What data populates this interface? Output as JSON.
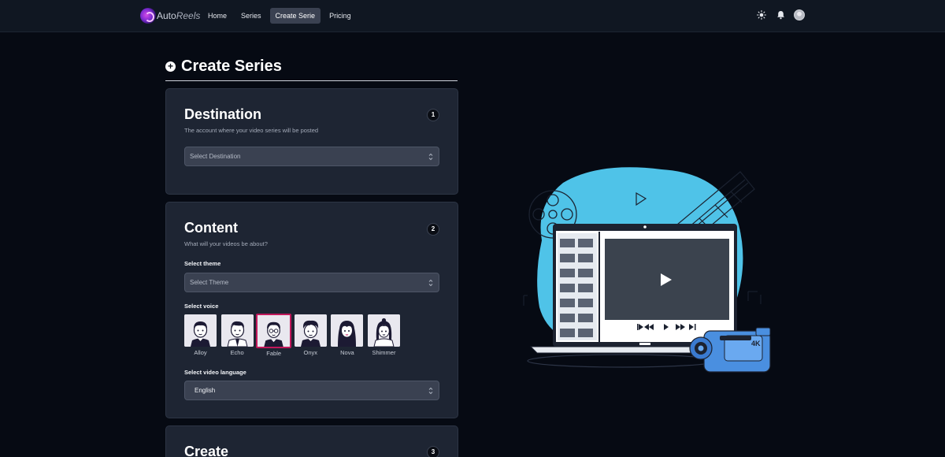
{
  "navbar": {
    "logo": {
      "brand_part1": "Auto",
      "brand_part2": "Reels"
    },
    "links": [
      {
        "label": "Home",
        "active": false
      },
      {
        "label": "Series",
        "active": false
      },
      {
        "label": "Create Serie",
        "active": true
      },
      {
        "label": "Pricing",
        "active": false
      }
    ],
    "icons": [
      "sun-icon",
      "bell-icon",
      "avatar"
    ]
  },
  "page": {
    "title": "Create Series",
    "title_icon": "plus-circle-icon"
  },
  "destination": {
    "step": "1",
    "title": "Destination",
    "description": "The account where your video series will be posted",
    "select_placeholder": "Select Destination"
  },
  "content": {
    "step": "2",
    "title": "Content",
    "description": "What will your videos be about?",
    "theme_label": "Select theme",
    "theme_placeholder": "Select Theme",
    "voice_label": "Select voice",
    "voices": [
      {
        "name": "Alloy",
        "selected": false
      },
      {
        "name": "Echo",
        "selected": false
      },
      {
        "name": "Fable",
        "selected": true
      },
      {
        "name": "Onyx",
        "selected": false
      },
      {
        "name": "Nova",
        "selected": false
      },
      {
        "name": "Shimmer",
        "selected": false
      }
    ],
    "language_label": "Select video language",
    "language_value": "English"
  },
  "create": {
    "step": "3",
    "title": "Create"
  },
  "illustration": {
    "badge_text": "4K"
  },
  "colors": {
    "background": "#060a13",
    "navbar": "#101722",
    "card": "#1e2533",
    "select": "#3a4151",
    "selected_voice_border": "#c2185b",
    "illustration_blob": "#4fc3e8"
  }
}
